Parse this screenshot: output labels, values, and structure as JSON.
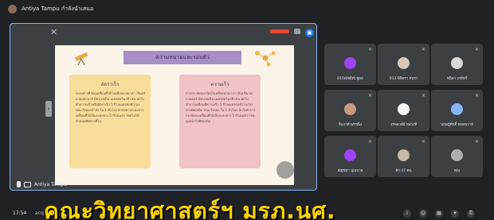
{
  "window": {
    "presenter_caption": "Antiya Tampu กำลังนำเสนอ"
  },
  "slide": {
    "title": "ความหมายและรอบตัว",
    "left_card": {
      "heading": "อัตราเร็ว",
      "body": "ระยะทางที่วัตถุเคลื่อนที่ได้ในหนึ่งหน่วยเวลา เป็นปริมาณสเกลาร์ มีหน่วยเป็น เมตรต่อวินาที เช่น นักวิ่งทำความเร็วหรืออัตราเร็ว 5 กิโลเมตรต่อชั่วโมง ขณะวิ่งออกกำลัง ใน 1 ชั่วโมง ท่านั่งทางระยะทางเคลื่อนที่ได้เป็นระยะทาง 5 กิโลเมตร โดยไม่ได้กำหนดทิศทางที่ไป"
    },
    "right_card": {
      "heading": "ความเร็ว",
      "body": "การกระจัดของวัตถุในหนึ่งหน่วยเวลา เป็นปริมาณเวกเตอร์ มีหน่วยเป็น เมตรต่อวินาที เช่น นักวิ่งทำการเคลื่อนที่ความเร็ว 5 กิโลเมตรต่อชั่วโมงไปทางทิศเหนือ ขณะวิ่งออก ใน 1 ชั่วโมง นักวิ่งทำการกระจัดจะเคลื่อนที่ได้เป็นระยะทาง 5 กิโลเมตร โดยมุ่งหน้าไปทิศเหนือ"
    }
  },
  "presenter": {
    "name": "Antiya Tampu"
  },
  "participants": [
    {
      "name": "015ณัชธิณี ชูผล",
      "color": "#a142f4"
    },
    {
      "name": "013 พิจิตรา จันรา",
      "color": "#d7c8b8"
    },
    {
      "name": "ชนิดา เกษีทวี",
      "color": "#d8d8d8"
    },
    {
      "name": "จินวาดี พรรณิ่ง",
      "color": "#c89a80"
    },
    {
      "name": "วรพลวลีย์ หลวงทิ",
      "color": "#f5f5f5"
    },
    {
      "name": "ปฤษฎีศักดิ์ ยอดขวาลี",
      "color": "#8ab4f8"
    },
    {
      "name": "ณัฐชดา ปุณบวล",
      "color": "#a142f4"
    },
    {
      "name": "อีก 47 คน",
      "color": "#c8b8a8"
    },
    {
      "name": "คุณ",
      "color": "#b0b0b0"
    }
  ],
  "bottombar": {
    "time": "17:54",
    "meeting_code": "acq"
  },
  "overlay_text": "คณะวิทยาศาสตร์ฯ มรภ.นศ."
}
